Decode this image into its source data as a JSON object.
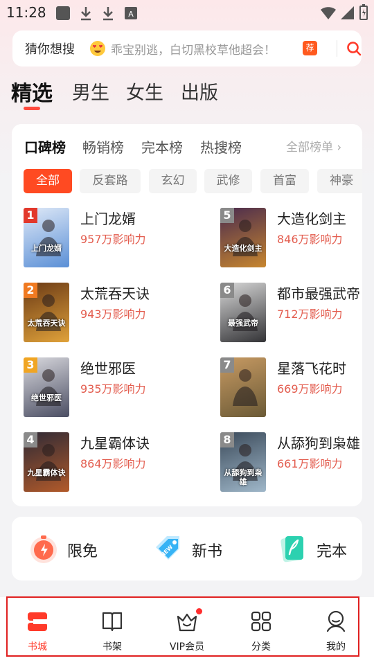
{
  "status_bar": {
    "time": "11:28"
  },
  "search": {
    "prefix": "猜你想搜",
    "hint": "乖宝别逃，白切黑校草他超会！",
    "badge": "荐"
  },
  "top_tabs": [
    "精选",
    "男生",
    "女生",
    "出版"
  ],
  "rank": {
    "tabs": [
      "口碑榜",
      "畅销榜",
      "完本榜",
      "热搜榜"
    ],
    "all_lists": "全部榜单 ›",
    "chips": [
      "全部",
      "反套路",
      "玄幻",
      "武修",
      "首富",
      "神豪"
    ],
    "books": [
      {
        "rank": "1",
        "title": "上门龙婿",
        "meta": "957万影响力",
        "cover_text": "上门龙婿",
        "badge_color": "#e2382b",
        "cover_colors": [
          "#dfe9f7",
          "#5a8fd6"
        ]
      },
      {
        "rank": "2",
        "title": "太荒吞天诀",
        "meta": "943万影响力",
        "cover_text": "太荒吞天诀",
        "badge_color": "#f07a21",
        "cover_colors": [
          "#6b3a16",
          "#e0a23a"
        ]
      },
      {
        "rank": "3",
        "title": "绝世邪医",
        "meta": "935万影响力",
        "cover_text": "绝世邪医",
        "badge_color": "#f0a523",
        "cover_colors": [
          "#d9d9de",
          "#4b4e63"
        ]
      },
      {
        "rank": "4",
        "title": "九星霸体诀",
        "meta": "864万影响力",
        "cover_text": "九星霸体诀",
        "badge_color": "#8a8a8a",
        "cover_colors": [
          "#2e2a36",
          "#b25a2a"
        ]
      },
      {
        "rank": "5",
        "title": "大造化剑主",
        "meta": "846万影响力",
        "cover_text": "大造化剑主",
        "badge_color": "#8a8a8a",
        "cover_colors": [
          "#4a2b4e",
          "#c7862f"
        ]
      },
      {
        "rank": "6",
        "title": "都市最强武帝",
        "meta": "712万影响力",
        "cover_text": "最强武帝",
        "badge_color": "#8a8a8a",
        "cover_colors": [
          "#d8d8d8",
          "#333336"
        ]
      },
      {
        "rank": "7",
        "title": "星落飞花时",
        "meta": "669万影响力",
        "cover_text": "",
        "badge_color": "#8a8a8a",
        "cover_colors": [
          "#c79a63",
          "#6b5a36"
        ]
      },
      {
        "rank": "8",
        "title": "从舔狗到枭雄",
        "meta": "661万影响力",
        "cover_text": "从舔狗到枭雄",
        "badge_color": "#8a8a8a",
        "cover_colors": [
          "#3b4a5a",
          "#9fb7c9"
        ]
      }
    ]
  },
  "quick": [
    {
      "label": "限免",
      "icon": "stopwatch-icon"
    },
    {
      "label": "新书",
      "icon": "new-tag-icon"
    },
    {
      "label": "完本",
      "icon": "book-done-icon"
    }
  ],
  "nav": [
    {
      "label": "书城",
      "icon": "bookstore-icon"
    },
    {
      "label": "书架",
      "icon": "bookshelf-icon"
    },
    {
      "label": "VIP会员",
      "icon": "vip-crown-icon"
    },
    {
      "label": "分类",
      "icon": "category-grid-icon"
    },
    {
      "label": "我的",
      "icon": "profile-icon"
    }
  ],
  "colors": {
    "accent": "#ff4a22",
    "meta": "#e35d4f",
    "frame": "#e02020"
  }
}
